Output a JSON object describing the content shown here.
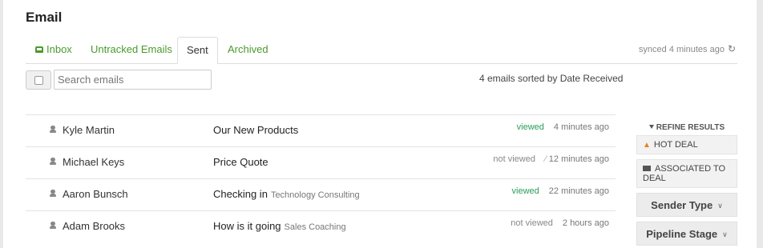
{
  "page": {
    "title": "Email"
  },
  "tabs": [
    {
      "label": "Inbox",
      "icon": "inbox-icon"
    },
    {
      "label": "Untracked Emails"
    },
    {
      "label": "Sent"
    },
    {
      "label": "Archived"
    }
  ],
  "synced": {
    "text": "synced 4 minutes ago",
    "icon": "refresh-icon"
  },
  "toolbar": {
    "search_placeholder": "Search emails",
    "sort_info": "4 emails sorted by Date Received"
  },
  "emails": [
    {
      "name": "Kyle Martin",
      "subject": "Our New Products",
      "tag": "",
      "status": "viewed",
      "attachment": false,
      "time": "4 minutes ago"
    },
    {
      "name": "Michael Keys",
      "subject": "Price Quote",
      "tag": "",
      "status": "not viewed",
      "attachment": true,
      "time": "12 minutes ago"
    },
    {
      "name": "Aaron Bunsch",
      "subject": "Checking in",
      "tag": "Technology Consulting",
      "status": "viewed",
      "attachment": false,
      "time": "22 minutes ago"
    },
    {
      "name": "Adam Brooks",
      "subject": "How is it going",
      "tag": "Sales Coaching",
      "status": "not viewed",
      "attachment": false,
      "time": "2 hours ago"
    }
  ],
  "sidebar": {
    "refine_label": "REFINE RESULTS",
    "filters": [
      {
        "label": "HOT DEAL",
        "icon": "flame-icon"
      },
      {
        "label": "ASSOCIATED TO DEAL",
        "icon": "deal-badge-icon"
      }
    ],
    "dropdowns": [
      {
        "label": "Sender Type"
      },
      {
        "label": "Pipeline Stage"
      }
    ]
  },
  "colors": {
    "link_green": "#4a9a2e",
    "viewed_green": "#2a9d5a",
    "flame_orange": "#e8821e"
  }
}
